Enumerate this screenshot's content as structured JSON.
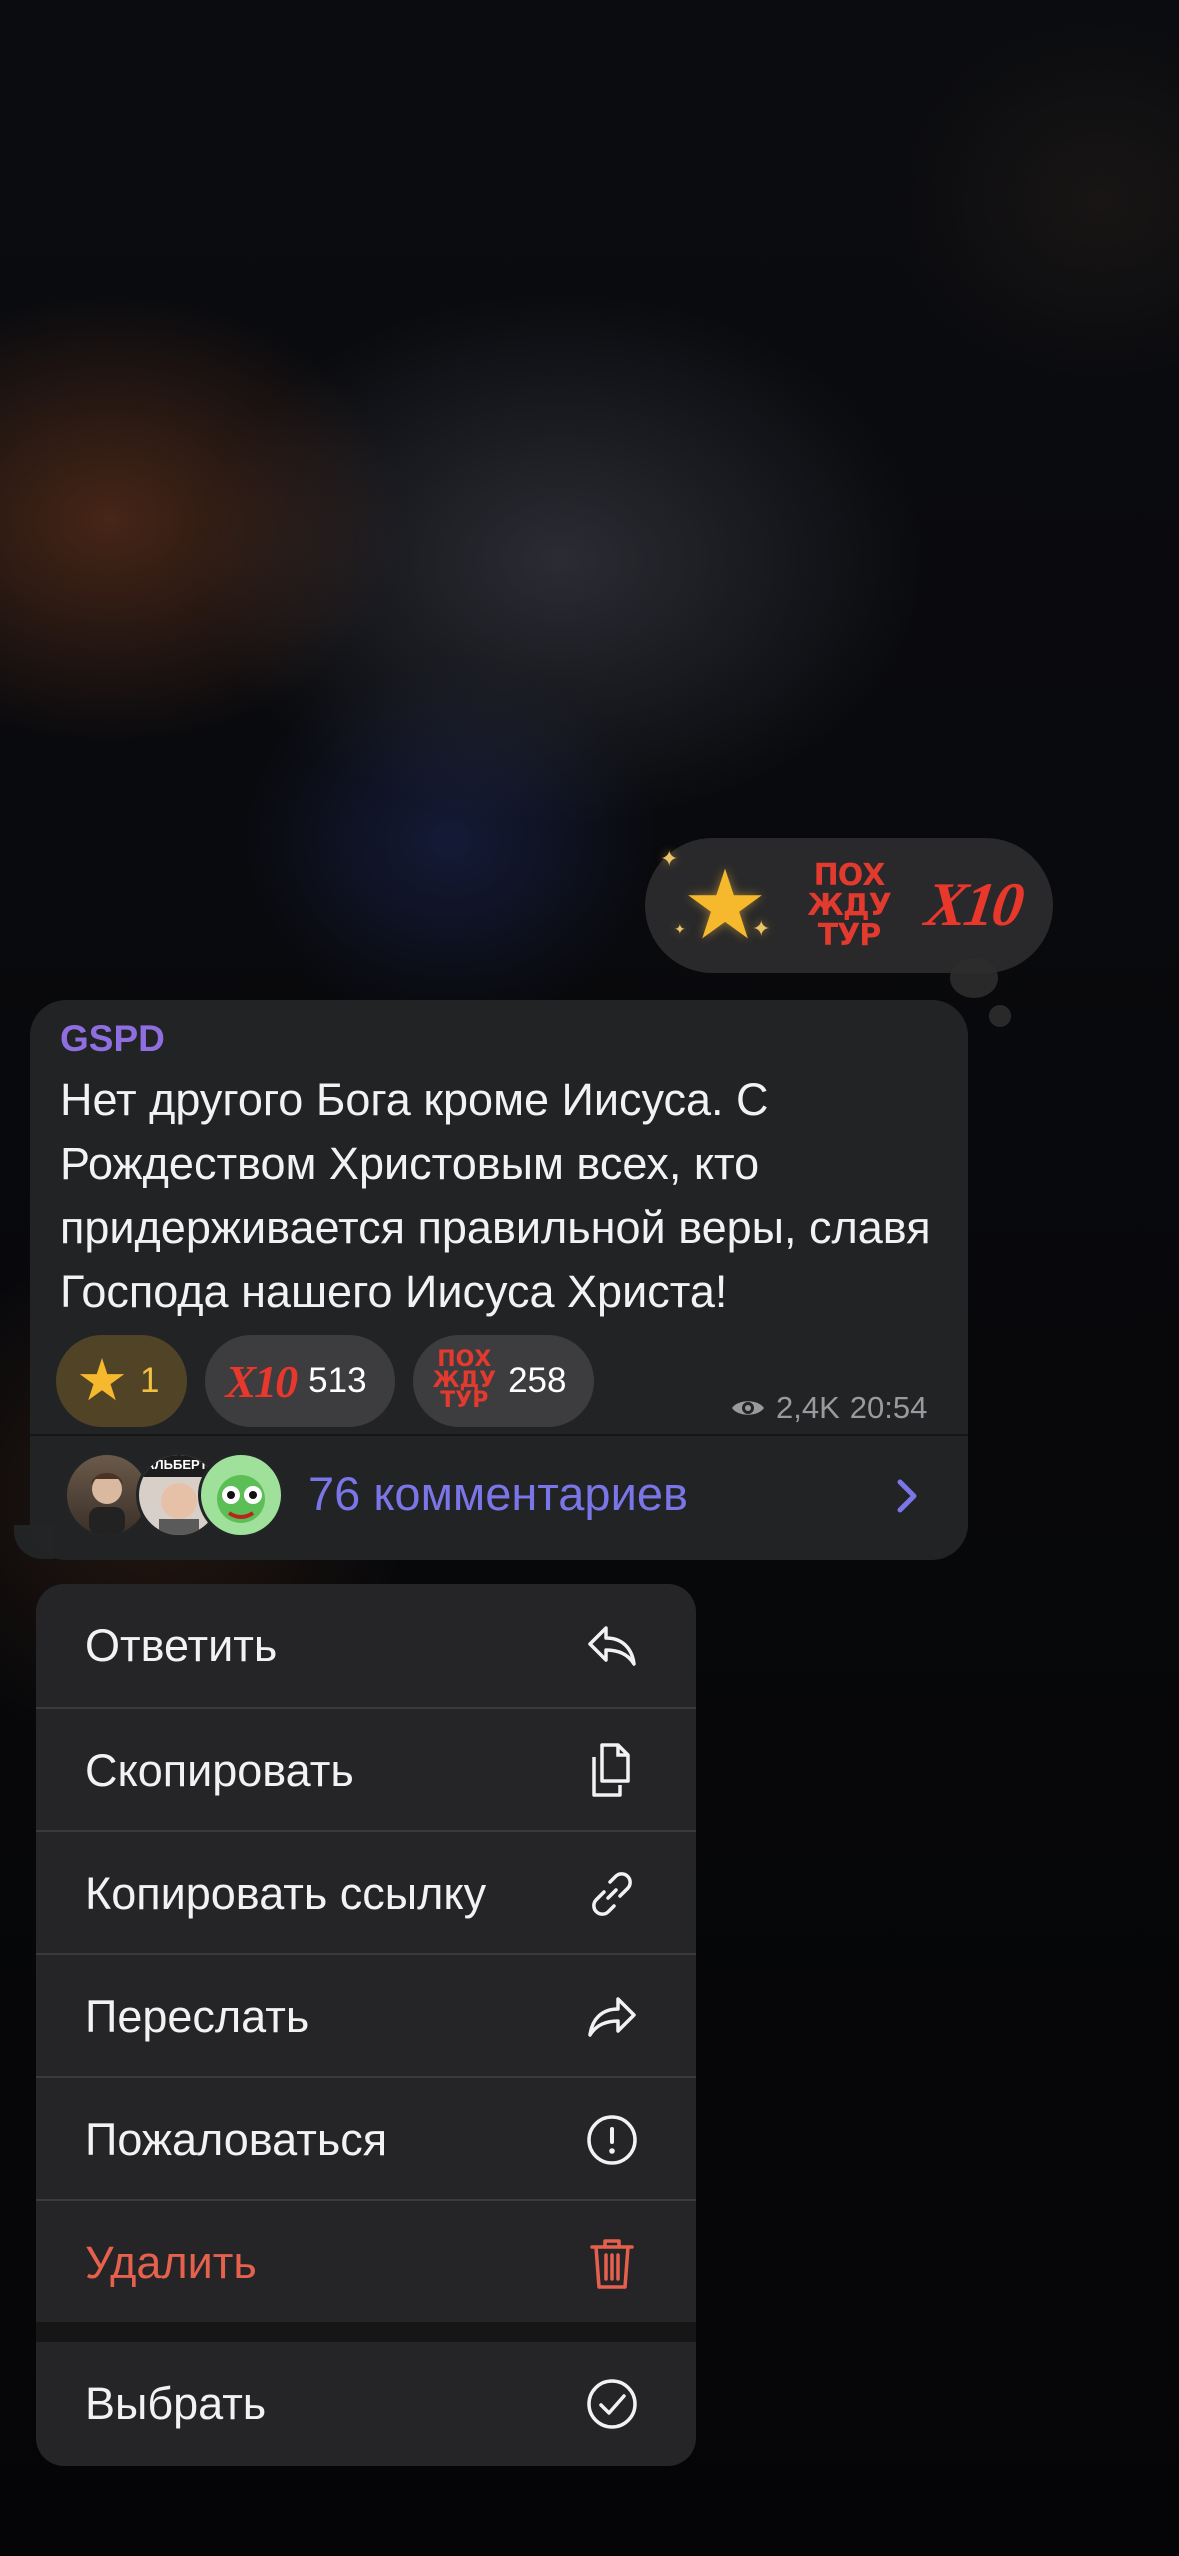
{
  "reaction_picker": {
    "items": [
      {
        "icon": "star-icon"
      },
      {
        "icon": "pokh-zhdu-tur-sticker",
        "text_lines": [
          "ПОХ",
          "ЖДУ",
          "ТУР"
        ]
      },
      {
        "icon": "x10-sticker",
        "text": "X10"
      }
    ]
  },
  "message": {
    "sender": "GSPD",
    "text": "Нет другого Бога кроме Иисуса. С Рождеством Христовым всех, кто придерживается правильной веры, славя Господа нашего Иисуса Христа!",
    "reactions": [
      {
        "icon": "star-icon",
        "count": "1",
        "active": true
      },
      {
        "icon": "x10-sticker",
        "label": "X10",
        "count": "513"
      },
      {
        "icon": "pokh-zhdu-tur-sticker",
        "label_lines": [
          "ПОХ",
          "ЖДУ",
          "ТУР"
        ],
        "count": "258"
      }
    ],
    "views": "2,4K",
    "time": "20:54",
    "comments_label": "76 комментариев",
    "avatar_caption": "АЛЬБЕРТ"
  },
  "menu": {
    "items": [
      {
        "label": "Ответить",
        "icon": "reply-icon"
      },
      {
        "label": "Скопировать",
        "icon": "copy-icon"
      },
      {
        "label": "Копировать ссылку",
        "icon": "link-icon"
      },
      {
        "label": "Переслать",
        "icon": "forward-icon"
      },
      {
        "label": "Пожаловаться",
        "icon": "report-icon"
      },
      {
        "label": "Удалить",
        "icon": "trash-icon",
        "danger": true
      },
      {
        "label": "Выбрать",
        "icon": "check-circle-icon"
      }
    ]
  },
  "colors": {
    "accent_link": "#7b76e8",
    "sender_name": "#8f6fe0",
    "danger": "#e5614d",
    "star": "#f6b82c"
  }
}
